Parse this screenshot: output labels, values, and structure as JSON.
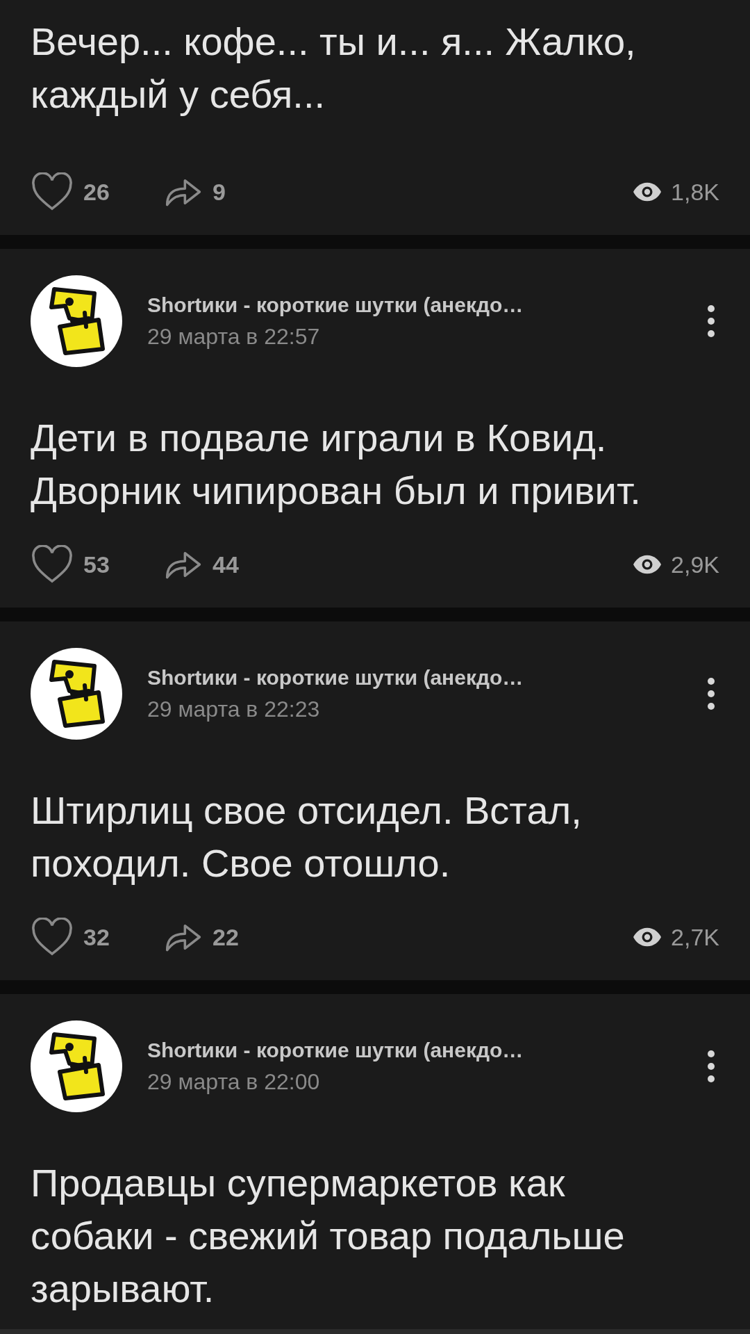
{
  "posts": [
    {
      "text": "Вечер... кофе... ты и... я... Жалко, каждый у себя...",
      "likes": "26",
      "shares": "9",
      "views": "1,8K"
    },
    {
      "author": "Shortики - короткие шутки (анекдо…",
      "date": "29 марта в 22:57",
      "text": "Дети в подвале играли в Ковид. Дворник чипирован был и привит.",
      "likes": "53",
      "shares": "44",
      "views": "2,9K"
    },
    {
      "author": "Shortики - короткие шутки (анекдо…",
      "date": "29 марта в 22:23",
      "text": "Штирлиц свое отсидел. Встал, походил. Свое отошло.",
      "likes": "32",
      "shares": "22",
      "views": "2,7K"
    },
    {
      "author": "Shortики - короткие шутки (анекдо…",
      "date": "29 марта в 22:00",
      "text": "Продавцы супермаркетов как собаки - свежий товар подальше зарывают."
    }
  ]
}
